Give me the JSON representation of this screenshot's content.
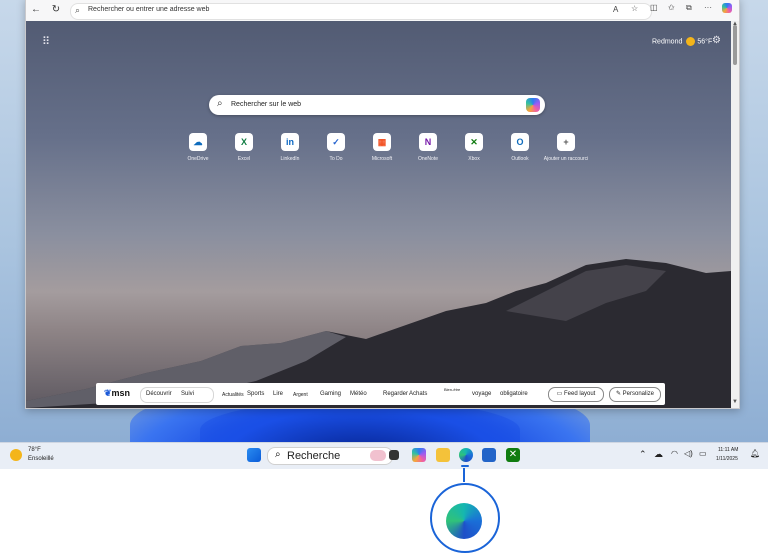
{
  "browser": {
    "address_placeholder": "Rechercher ou entrer une adresse web",
    "toolbar_icons": [
      "back-icon",
      "refresh-icon",
      "read-aloud-icon",
      "favorite-icon",
      "split-screen-icon",
      "favorites-icon",
      "collections-icon",
      "more-icon",
      "copilot-icon"
    ]
  },
  "ntp": {
    "weather_city": "Redmond",
    "weather_temp": "56°F",
    "search_placeholder": "Rechercher sur le web",
    "quick_links": [
      {
        "label": "OneDrive",
        "color": "#0f6cbd",
        "glyph": "☁"
      },
      {
        "label": "Excel",
        "color": "#107c41",
        "glyph": "X"
      },
      {
        "label": "LinkedIn",
        "color": "#0a66c2",
        "glyph": "in"
      },
      {
        "label": "To Do",
        "color": "#2564cf",
        "glyph": "✓"
      },
      {
        "label": "Microsoft",
        "color": "#f25022",
        "glyph": "▦"
      },
      {
        "label": "OneNote",
        "color": "#7719aa",
        "glyph": "N"
      },
      {
        "label": "Xbox",
        "color": "#107c10",
        "glyph": "✕"
      },
      {
        "label": "Outlook",
        "color": "#0f6cbd",
        "glyph": "O"
      },
      {
        "label": "Ajouter un raccourci",
        "color": "#555555",
        "glyph": "+"
      }
    ],
    "feed": {
      "logo": "msn",
      "tabs": [
        "Découvrir",
        "Suivi"
      ],
      "categories": [
        "Actualités",
        "Sports",
        "Lire",
        "Argent",
        "Gaming",
        "Météo",
        "Regarder",
        "Achats",
        "Bien-être",
        "voyage",
        "obligatoire"
      ],
      "feed_layout": "Feed layout",
      "personalize": "Personalize"
    }
  },
  "taskbar": {
    "weather_temp": "78°F",
    "weather_cond": "Ensoleillé",
    "search_label": "Recherche",
    "time": "11:11 AM",
    "date": "1/11/2025"
  }
}
